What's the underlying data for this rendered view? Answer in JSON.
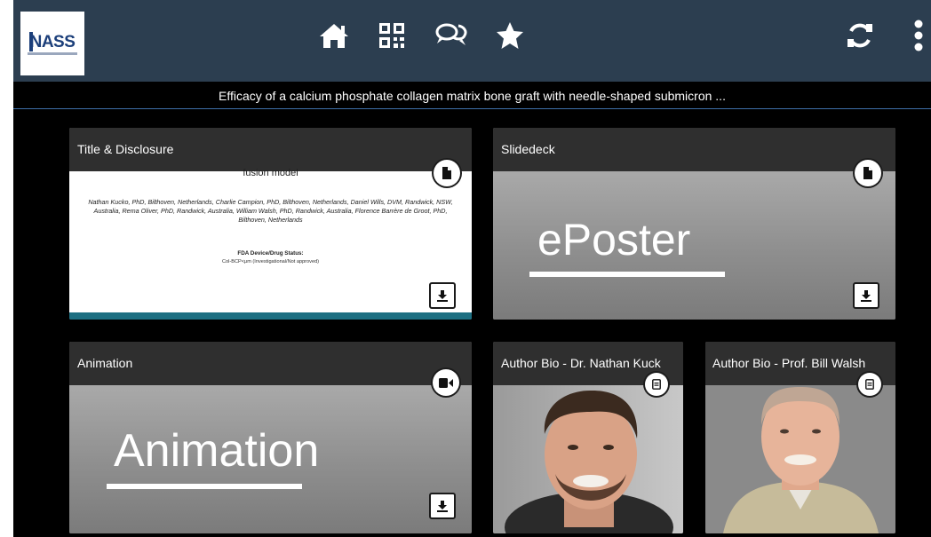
{
  "app": {
    "logo_text": "NASS",
    "nav": [
      {
        "name": "home",
        "icon": "home-icon"
      },
      {
        "name": "qr-code",
        "icon": "qr-code-icon"
      },
      {
        "name": "chat",
        "icon": "chat-icon"
      },
      {
        "name": "favorites",
        "icon": "star-icon"
      }
    ],
    "refresh_icon": "refresh-icon",
    "more_icon": "more-vertical-icon"
  },
  "page_title": "Efficacy of a calcium phosphate collagen matrix bone graft with needle-shaped submicron ...",
  "cards": {
    "title_disclosure": {
      "title": "Title & Disclosure",
      "icon": "document-icon",
      "preview": {
        "heading": "fusion model",
        "authors": "Nathan Kucko, PhD, Bilthoven, Netherlands, Charlie Campion, PhD, Bilthoven, Netherlands, Daniel Wills, DVM, Randwick, NSW, Australia, Rema Oliver, PhD, Randwick, Australia, William Walsh, PhD, Randwick, Australia, Florence Barrère de Groot, PhD, Bilthoven, Netherlands",
        "fda_label": "FDA Device/Drug Status:",
        "fda_status": "Col-BCP<μm (Investigational/Not approved)"
      }
    },
    "slidedeck": {
      "title": "Slidedeck",
      "icon": "document-icon",
      "cover_text": "ePoster"
    },
    "animation": {
      "title": "Animation",
      "icon": "video-camera-icon",
      "cover_text": "Animation"
    },
    "bio_kuck": {
      "title": "Author Bio - Dr. Nathan Kuck",
      "icon": "file-text-icon"
    },
    "bio_walsh": {
      "title": "Author Bio - Prof. Bill Walsh",
      "icon": "file-text-icon"
    }
  },
  "colors": {
    "topbar": "#2c3e50",
    "background": "#000000",
    "card_header": "#2f2f2f",
    "logo_blue": "#1c3f7a"
  }
}
